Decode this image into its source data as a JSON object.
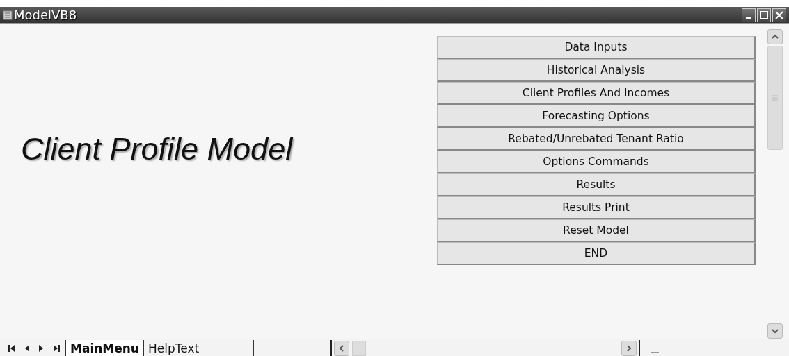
{
  "window": {
    "title": "ModelVB8"
  },
  "heading": "Client Profile Model",
  "buttons": [
    "Data Inputs",
    "Historical Analysis",
    "Client Profiles And Incomes",
    "Forecasting Options",
    "Rebated/Unrebated Tenant Ratio",
    "Options Commands",
    "Results",
    "Results Print",
    "Reset Model",
    "END"
  ],
  "sheet_tabs": [
    {
      "label": "MainMenu",
      "selected": true
    },
    {
      "label": "HelpText",
      "selected": false
    }
  ]
}
